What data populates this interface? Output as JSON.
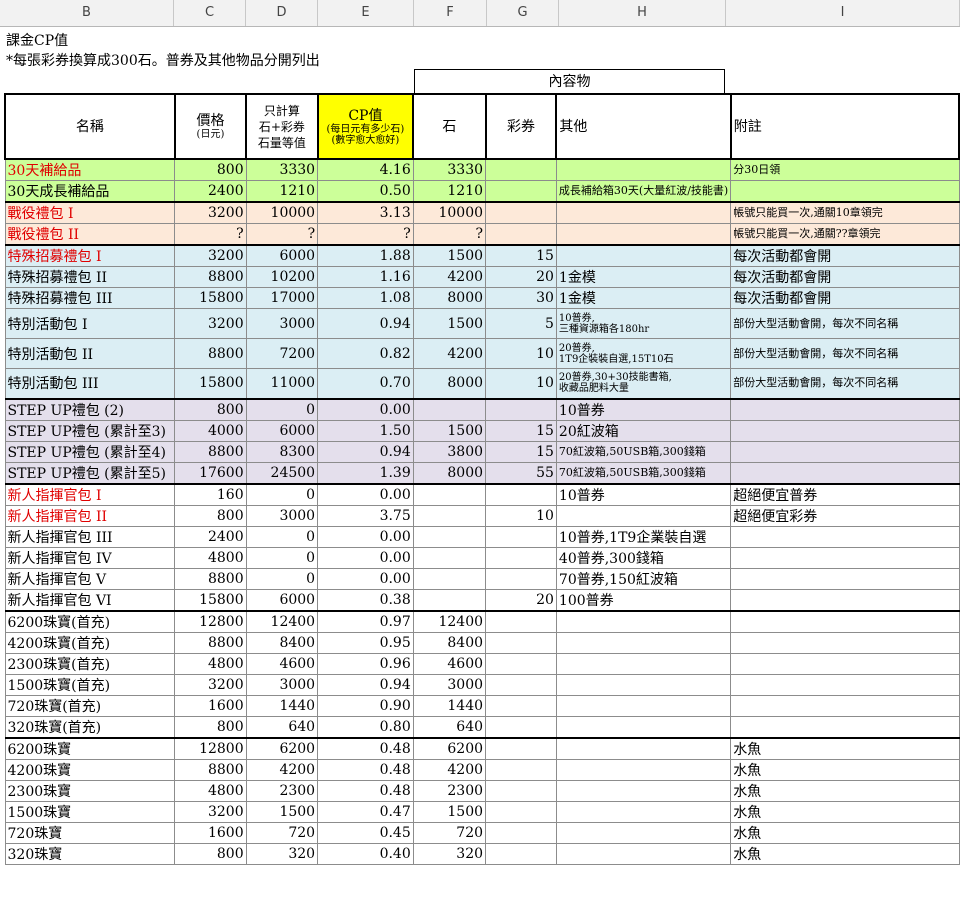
{
  "columns": [
    "B",
    "C",
    "D",
    "E",
    "F",
    "G",
    "H",
    "I"
  ],
  "title": "課金CP值",
  "note": "*每張彩券換算成300石。普券及其他物品分開列出",
  "group_header": "內容物",
  "header": {
    "name": "名稱",
    "price": "價格",
    "price_unit": "(日元)",
    "equiv_1": "只計算",
    "equiv_2": "石+彩券",
    "equiv_3": "石量等值",
    "cp": "CP值",
    "cp_sub1": "(每日元有多少石)",
    "cp_sub2": "(數字愈大愈好)",
    "stone": "石",
    "ticket": "彩券",
    "other": "其他",
    "note": "附註"
  },
  "colors": {
    "green": "#ccff99",
    "peach": "#fde9d9",
    "blue": "#dbeef4",
    "purple": "#e4dfec",
    "white": "#ffffff",
    "yellow": "#ffff00",
    "red_text": "#e00000"
  },
  "rows": [
    {
      "name": "30天補給品",
      "price": "800",
      "equiv": "3330",
      "cp": "4.16",
      "stone": "3330",
      "ticket": "",
      "other": "",
      "note": "分30日領",
      "bg": "green",
      "red": true,
      "top": false
    },
    {
      "name": "30天成長補給品",
      "price": "2400",
      "equiv": "1210",
      "cp": "0.50",
      "stone": "1210",
      "ticket": "",
      "other": "成長補給箱30天(大量紅波/技能書)",
      "note": "",
      "bg": "green",
      "red": false,
      "top": false
    },
    {
      "name": "戰役禮包 I",
      "price": "3200",
      "equiv": "10000",
      "cp": "3.13",
      "stone": "10000",
      "ticket": "",
      "other": "",
      "note": "帳號只能買一次,通關10章領完",
      "bg": "peach",
      "red": true,
      "top": true
    },
    {
      "name": "戰役禮包 II",
      "price": "?",
      "equiv": "?",
      "cp": "?",
      "stone": "?",
      "ticket": "",
      "other": "",
      "note": "帳號只能買一次,通關??章領完",
      "bg": "peach",
      "red": true,
      "top": false
    },
    {
      "name": "特殊招募禮包 I",
      "price": "3200",
      "equiv": "6000",
      "cp": "1.88",
      "stone": "1500",
      "ticket": "15",
      "other": "",
      "note": "每次活動都會開",
      "bg": "blue",
      "red": true,
      "top": true
    },
    {
      "name": "特殊招募禮包 II",
      "price": "8800",
      "equiv": "10200",
      "cp": "1.16",
      "stone": "4200",
      "ticket": "20",
      "other": "1金模",
      "note": "每次活動都會開",
      "bg": "blue",
      "red": false,
      "top": false
    },
    {
      "name": "特殊招募禮包 III",
      "price": "15800",
      "equiv": "17000",
      "cp": "1.08",
      "stone": "8000",
      "ticket": "30",
      "other": "1金模",
      "note": "每次活動都會開",
      "bg": "blue",
      "red": false,
      "top": false
    },
    {
      "name": "特別活動包 I",
      "price": "3200",
      "equiv": "3000",
      "cp": "0.94",
      "stone": "1500",
      "ticket": "5",
      "other": "10普券,\n三種資源箱各180hr",
      "note": "部份大型活動會開，每次不同名稱",
      "bg": "blue",
      "red": false,
      "top": false,
      "tall": true
    },
    {
      "name": "特別活動包 II",
      "price": "8800",
      "equiv": "7200",
      "cp": "0.82",
      "stone": "4200",
      "ticket": "10",
      "other": "20普券,\n1T9企裝裝自選,15T10石",
      "note": "部份大型活動會開，每次不同名稱",
      "bg": "blue",
      "red": false,
      "top": false,
      "tall": true
    },
    {
      "name": "特別活動包 III",
      "price": "15800",
      "equiv": "11000",
      "cp": "0.70",
      "stone": "8000",
      "ticket": "10",
      "other": "20普券,30+30技能書箱,\n收藏品肥料大量",
      "note": "部份大型活動會開，每次不同名稱",
      "bg": "blue",
      "red": false,
      "top": false,
      "tall": true
    },
    {
      "name": "STEP UP禮包 (2)",
      "price": "800",
      "equiv": "0",
      "cp": "0.00",
      "stone": "",
      "ticket": "",
      "other": "10普券",
      "note": "",
      "bg": "purple",
      "red": false,
      "top": true
    },
    {
      "name": "STEP UP禮包 (累計至3)",
      "price": "4000",
      "equiv": "6000",
      "cp": "1.50",
      "stone": "1500",
      "ticket": "15",
      "other": "20紅波箱",
      "note": "",
      "bg": "purple",
      "red": false,
      "top": false
    },
    {
      "name": "STEP UP禮包 (累計至4)",
      "price": "8800",
      "equiv": "8300",
      "cp": "0.94",
      "stone": "3800",
      "ticket": "15",
      "other": "70紅波箱,50USB箱,300錢箱",
      "note": "",
      "bg": "purple",
      "red": false,
      "top": false,
      "smallOther": true
    },
    {
      "name": "STEP UP禮包 (累計至5)",
      "price": "17600",
      "equiv": "24500",
      "cp": "1.39",
      "stone": "8000",
      "ticket": "55",
      "other": "70紅波箱,50USB箱,300錢箱",
      "note": "",
      "bg": "purple",
      "red": false,
      "top": false,
      "smallOther": true
    },
    {
      "name": "新人指揮官包 I",
      "price": "160",
      "equiv": "0",
      "cp": "0.00",
      "stone": "",
      "ticket": "",
      "other": "10普券",
      "note": "超絕便宜普券",
      "bg": "white",
      "red": true,
      "top": true
    },
    {
      "name": "新人指揮官包 II",
      "price": "800",
      "equiv": "3000",
      "cp": "3.75",
      "stone": "",
      "ticket": "10",
      "other": "",
      "note": "超絕便宜彩券",
      "bg": "white",
      "red": true,
      "top": false
    },
    {
      "name": "新人指揮官包 III",
      "price": "2400",
      "equiv": "0",
      "cp": "0.00",
      "stone": "",
      "ticket": "",
      "other": "10普券,1T9企業裝自選",
      "note": "",
      "bg": "white",
      "red": false,
      "top": false
    },
    {
      "name": "新人指揮官包 IV",
      "price": "4800",
      "equiv": "0",
      "cp": "0.00",
      "stone": "",
      "ticket": "",
      "other": "40普券,300錢箱",
      "note": "",
      "bg": "white",
      "red": false,
      "top": false
    },
    {
      "name": "新人指揮官包 V",
      "price": "8800",
      "equiv": "0",
      "cp": "0.00",
      "stone": "",
      "ticket": "",
      "other": "70普券,150紅波箱",
      "note": "",
      "bg": "white",
      "red": false,
      "top": false
    },
    {
      "name": "新人指揮官包 VI",
      "price": "15800",
      "equiv": "6000",
      "cp": "0.38",
      "stone": "",
      "ticket": "20",
      "other": "100普券",
      "note": "",
      "bg": "white",
      "red": false,
      "top": false
    },
    {
      "name": "6200珠寶(首充)",
      "price": "12800",
      "equiv": "12400",
      "cp": "0.97",
      "stone": "12400",
      "ticket": "",
      "other": "",
      "note": "",
      "bg": "white",
      "red": false,
      "top": true
    },
    {
      "name": "4200珠寶(首充)",
      "price": "8800",
      "equiv": "8400",
      "cp": "0.95",
      "stone": "8400",
      "ticket": "",
      "other": "",
      "note": "",
      "bg": "white",
      "red": false,
      "top": false
    },
    {
      "name": "2300珠寶(首充)",
      "price": "4800",
      "equiv": "4600",
      "cp": "0.96",
      "stone": "4600",
      "ticket": "",
      "other": "",
      "note": "",
      "bg": "white",
      "red": false,
      "top": false
    },
    {
      "name": "1500珠寶(首充)",
      "price": "3200",
      "equiv": "3000",
      "cp": "0.94",
      "stone": "3000",
      "ticket": "",
      "other": "",
      "note": "",
      "bg": "white",
      "red": false,
      "top": false
    },
    {
      "name": "720珠寶(首充)",
      "price": "1600",
      "equiv": "1440",
      "cp": "0.90",
      "stone": "1440",
      "ticket": "",
      "other": "",
      "note": "",
      "bg": "white",
      "red": false,
      "top": false
    },
    {
      "name": "320珠寶(首充)",
      "price": "800",
      "equiv": "640",
      "cp": "0.80",
      "stone": "640",
      "ticket": "",
      "other": "",
      "note": "",
      "bg": "white",
      "red": false,
      "top": false
    },
    {
      "name": "6200珠寶",
      "price": "12800",
      "equiv": "6200",
      "cp": "0.48",
      "stone": "6200",
      "ticket": "",
      "other": "",
      "note": "水魚",
      "bg": "white",
      "red": false,
      "top": true
    },
    {
      "name": "4200珠寶",
      "price": "8800",
      "equiv": "4200",
      "cp": "0.48",
      "stone": "4200",
      "ticket": "",
      "other": "",
      "note": "水魚",
      "bg": "white",
      "red": false,
      "top": false
    },
    {
      "name": "2300珠寶",
      "price": "4800",
      "equiv": "2300",
      "cp": "0.48",
      "stone": "2300",
      "ticket": "",
      "other": "",
      "note": "水魚",
      "bg": "white",
      "red": false,
      "top": false
    },
    {
      "name": "1500珠寶",
      "price": "3200",
      "equiv": "1500",
      "cp": "0.47",
      "stone": "1500",
      "ticket": "",
      "other": "",
      "note": "水魚",
      "bg": "white",
      "red": false,
      "top": false
    },
    {
      "name": "720珠寶",
      "price": "1600",
      "equiv": "720",
      "cp": "0.45",
      "stone": "720",
      "ticket": "",
      "other": "",
      "note": "水魚",
      "bg": "white",
      "red": false,
      "top": false
    },
    {
      "name": "320珠寶",
      "price": "800",
      "equiv": "320",
      "cp": "0.40",
      "stone": "320",
      "ticket": "",
      "other": "",
      "note": "水魚",
      "bg": "white",
      "red": false,
      "top": false
    }
  ]
}
